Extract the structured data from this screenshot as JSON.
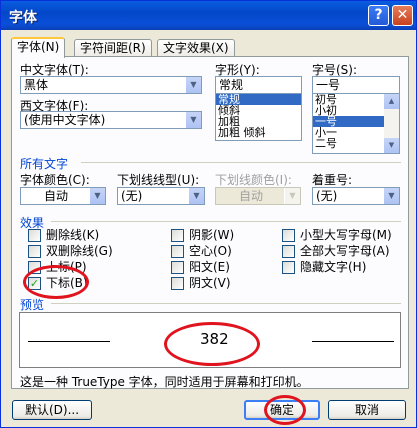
{
  "window": {
    "title": "字体",
    "help_glyph": "?",
    "close_glyph": "✕"
  },
  "tabs": [
    {
      "label": "字体(N)",
      "active": true
    },
    {
      "label": "字符间距(R)",
      "active": false
    },
    {
      "label": "文字效果(X)",
      "active": false
    }
  ],
  "font": {
    "cn_font_label": "中文字体(T):",
    "cn_font_value": "黑体",
    "west_font_label": "西文字体(F):",
    "west_font_value": "(使用中文字体)",
    "style_label": "字形(Y):",
    "style_value": "常规",
    "style_options": [
      "常规",
      "倾斜",
      "加粗",
      "加粗 倾斜"
    ],
    "size_label": "字号(S):",
    "size_value": "一号",
    "size_options": [
      "初号",
      "小初",
      "一号",
      "小一",
      "二号"
    ]
  },
  "all_text": {
    "section_label": "所有文字",
    "color_label": "字体颜色(C):",
    "color_value": "自动",
    "underline_label": "下划线线型(U):",
    "underline_value": "(无)",
    "underline_color_label": "下划线颜色(I):",
    "underline_color_value": "自动",
    "emphasis_label": "着重号:",
    "emphasis_value": "(无)"
  },
  "effects": {
    "section_label": "效果",
    "items": [
      {
        "label": "删除线(K)",
        "checked": false
      },
      {
        "label": "双删除线(G)",
        "checked": false
      },
      {
        "label": "上标(P)",
        "checked": false
      },
      {
        "label": "下标(B)",
        "checked": true
      },
      {
        "label": "阴影(W)",
        "checked": false
      },
      {
        "label": "空心(O)",
        "checked": false
      },
      {
        "label": "阳文(E)",
        "checked": false
      },
      {
        "label": "阴文(V)",
        "checked": false
      },
      {
        "label": "小型大写字母(M)",
        "checked": false
      },
      {
        "label": "全部大写字母(A)",
        "checked": false
      },
      {
        "label": "隐藏文字(H)",
        "checked": false
      }
    ]
  },
  "preview": {
    "section_label": "预览",
    "sample_text": "382",
    "note": "这是一种 TrueType 字体，同时适用于屏幕和打印机。"
  },
  "buttons": {
    "default_label": "默认(D)...",
    "ok_label": "确定",
    "cancel_label": "取消"
  },
  "annotation_color": "#e0141e"
}
